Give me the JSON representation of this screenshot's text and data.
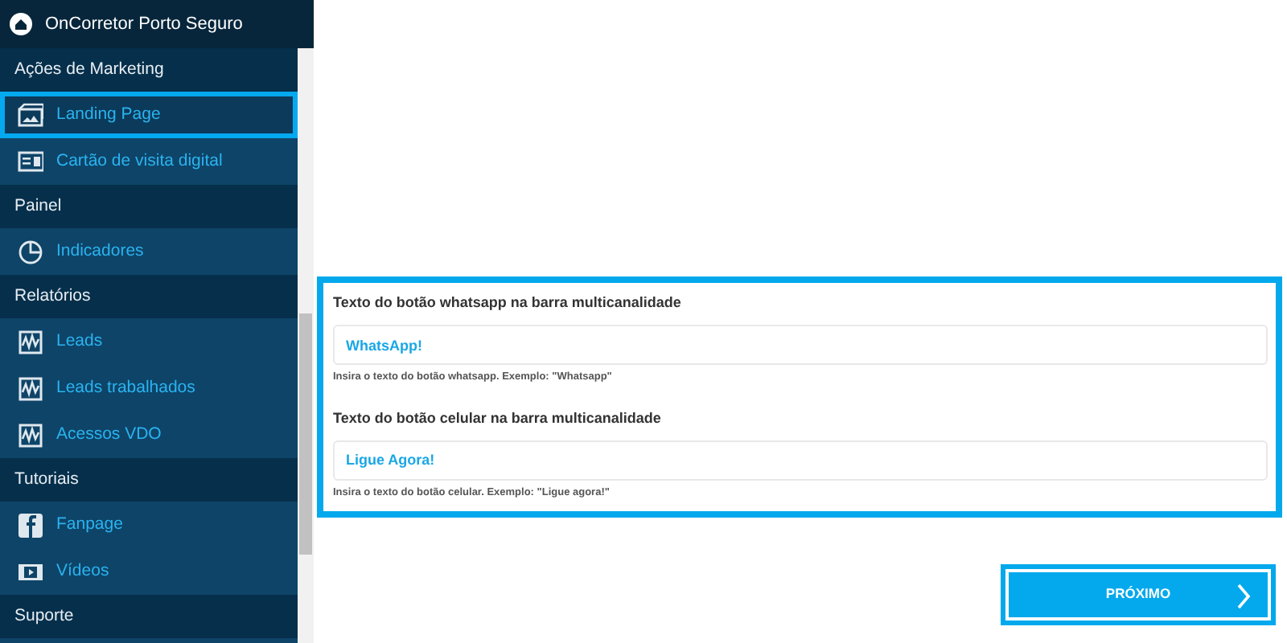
{
  "header": {
    "title": "OnCorretor Porto Seguro"
  },
  "sidebar": {
    "sections": [
      {
        "title": "Ações de Marketing",
        "items": [
          {
            "label": "Landing Page",
            "kind": "landing",
            "selected": true
          },
          {
            "label": "Cartão de visita digital",
            "kind": "card",
            "selected": false
          }
        ]
      },
      {
        "title": "Painel",
        "items": [
          {
            "label": "Indicadores",
            "kind": "pie",
            "selected": false
          }
        ]
      },
      {
        "title": "Relatórios",
        "items": [
          {
            "label": "Leads",
            "kind": "chart",
            "selected": false
          },
          {
            "label": "Leads trabalhados",
            "kind": "chart",
            "selected": false
          },
          {
            "label": "Acessos VDO",
            "kind": "chart",
            "selected": false
          }
        ]
      },
      {
        "title": "Tutoriais",
        "items": [
          {
            "label": "Fanpage",
            "kind": "facebook",
            "selected": false
          },
          {
            "label": "Vídeos",
            "kind": "video",
            "selected": false
          }
        ]
      },
      {
        "title": "Suporte"
      }
    ]
  },
  "form": {
    "fields": [
      {
        "label": "Texto do botão whatsapp na barra multicanalidade",
        "value": "WhatsApp!",
        "help": "Insira o texto do botão whatsapp. Exemplo: \"Whatsapp\""
      },
      {
        "label": "Texto do botão celular na barra multicanalidade",
        "value": "Ligue Agora!",
        "help": "Insira o texto do botão celular. Exemplo: \"Ligue agora!\""
      }
    ]
  },
  "next_button": {
    "label": "PRÓXIMO"
  }
}
